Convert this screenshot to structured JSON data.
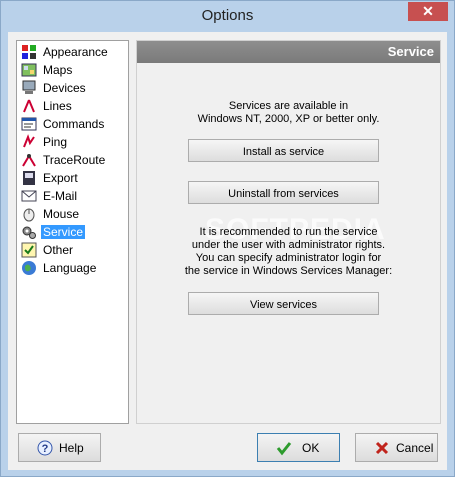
{
  "window": {
    "title": "Options",
    "close_icon": "close-icon"
  },
  "sidebar": {
    "items": [
      {
        "label": "Appearance",
        "icon": "appearance-icon"
      },
      {
        "label": "Maps",
        "icon": "maps-icon"
      },
      {
        "label": "Devices",
        "icon": "devices-icon"
      },
      {
        "label": "Lines",
        "icon": "lines-icon"
      },
      {
        "label": "Commands",
        "icon": "commands-icon"
      },
      {
        "label": "Ping",
        "icon": "ping-icon"
      },
      {
        "label": "TraceRoute",
        "icon": "traceroute-icon"
      },
      {
        "label": "Export",
        "icon": "export-icon"
      },
      {
        "label": "E-Mail",
        "icon": "email-icon"
      },
      {
        "label": "Mouse",
        "icon": "mouse-icon"
      },
      {
        "label": "Service",
        "icon": "service-icon",
        "selected": true
      },
      {
        "label": "Other",
        "icon": "other-icon"
      },
      {
        "label": "Language",
        "icon": "language-icon"
      }
    ]
  },
  "panel": {
    "title": "Service",
    "info_line1": "Services are available in",
    "info_line2": "Windows NT, 2000, XP or better only.",
    "install_label": "Install as service",
    "uninstall_label": "Uninstall from services",
    "rec_line1": "It is recommended to run the service",
    "rec_line2": "under the user with administrator rights.",
    "rec_line3": "You can specify administrator login for",
    "rec_line4": "the service in Windows Services Manager:",
    "view_label": "View services",
    "watermark": "SOFTPEDIA"
  },
  "footer": {
    "help_label": "Help",
    "ok_label": "OK",
    "cancel_label": "Cancel"
  },
  "colors": {
    "selection": "#3399ff",
    "header": "#808080",
    "ok_check": "#2d9b2d",
    "cancel_x": "#c0241c"
  }
}
